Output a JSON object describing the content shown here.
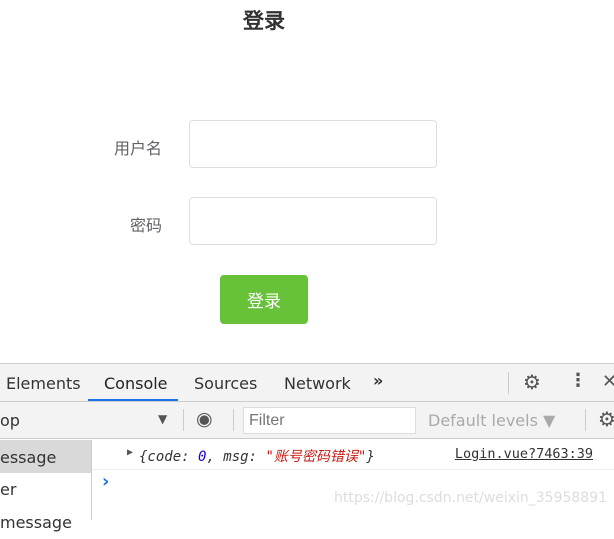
{
  "form": {
    "title": "登录",
    "username_label": "用户名",
    "password_label": "密码",
    "username_value": "",
    "password_value": "",
    "submit_label": "登录"
  },
  "devtools": {
    "tabs": [
      "Elements",
      "Console",
      "Sources",
      "Network"
    ],
    "more": "»",
    "context": "op",
    "filter_placeholder": "Filter",
    "levels": "Default levels ▼",
    "sidebar": [
      "essage",
      "er message"
    ],
    "log": {
      "prefix": "{code: ",
      "code": "0",
      ", msg: ": "",
      "mid": ", msg: ",
      "msg": "\"账号密码错误\"",
      "suffix": "}",
      "source": "Login.vue?7463:39"
    },
    "prompt": "›"
  },
  "watermark": "https://blog.csdn.net/weixin_35958891"
}
